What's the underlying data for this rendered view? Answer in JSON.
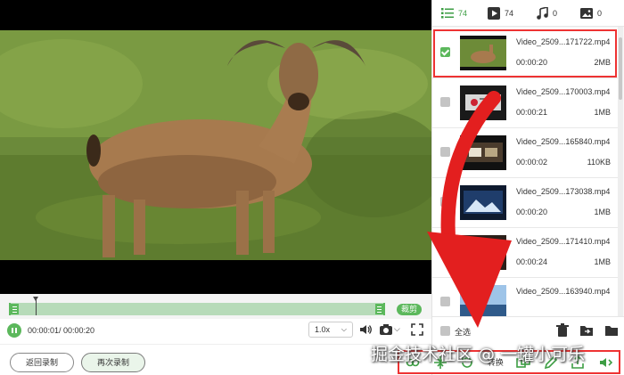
{
  "player": {
    "current_time": "00:00:01/ 00:00:20",
    "speed": "1.0x",
    "trim_label": "裁剪"
  },
  "bottom": {
    "back_label": "返回录制",
    "again_label": "再次录制"
  },
  "tabs": [
    {
      "icon": "list-icon",
      "count": "74"
    },
    {
      "icon": "video-icon",
      "count": "74"
    },
    {
      "icon": "music-icon",
      "count": "0"
    },
    {
      "icon": "image-icon",
      "count": "0"
    }
  ],
  "files": [
    {
      "name": "Video_2509...171722.mp4",
      "duration": "00:00:20",
      "size": "2MB",
      "checked": true
    },
    {
      "name": "Video_2509...170003.mp4",
      "duration": "00:00:21",
      "size": "1MB",
      "checked": false
    },
    {
      "name": "Video_2509...165840.mp4",
      "duration": "00:00:02",
      "size": "110KB",
      "checked": false
    },
    {
      "name": "Video_2509...173038.mp4",
      "duration": "00:00:20",
      "size": "1MB",
      "checked": false
    },
    {
      "name": "Video_2509...171410.mp4",
      "duration": "00:00:24",
      "size": "1MB",
      "checked": false
    },
    {
      "name": "Video_2509...163940.mp4",
      "duration": "",
      "size": "",
      "checked": false
    }
  ],
  "panel": {
    "select_all_label": "全选"
  },
  "tools": {
    "convert_label": "转换"
  },
  "watermark": "掘金技术社区 @ 一罐小可乐",
  "colors": {
    "accent": "#5cb85c",
    "highlight": "#e33333"
  }
}
